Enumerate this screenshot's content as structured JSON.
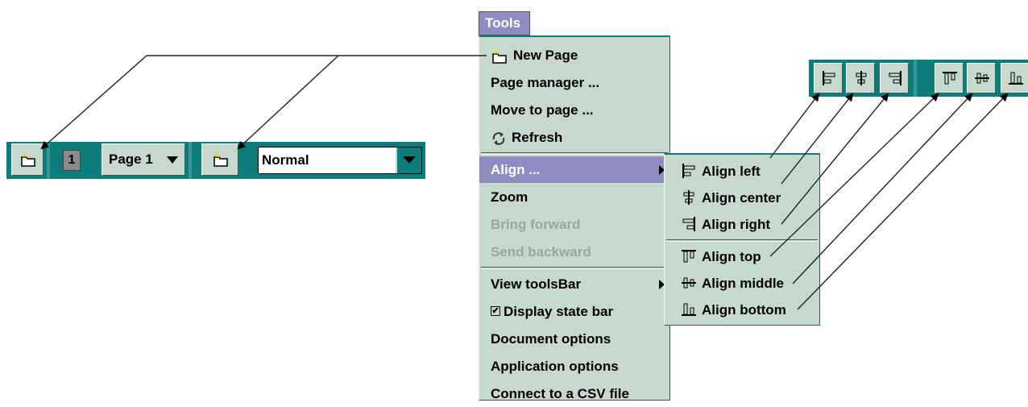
{
  "toolbar": {
    "page_number": "1",
    "page_select": "Page 1",
    "zoom_value": "Normal"
  },
  "menu": {
    "title": "Tools",
    "items": [
      {
        "label": "New Page",
        "icon": "new-page-icon",
        "enabled": true
      },
      {
        "label": "Page manager ...",
        "enabled": true
      },
      {
        "label": "Move to page ...",
        "enabled": true
      },
      {
        "label": "Refresh",
        "icon": "refresh-icon",
        "enabled": true
      },
      {
        "label": "Align ...",
        "enabled": true,
        "submenu": true,
        "selected": true
      },
      {
        "label": "Zoom",
        "enabled": true
      },
      {
        "label": "Bring forward",
        "enabled": false
      },
      {
        "label": "Send backward",
        "enabled": false
      },
      {
        "label": "View toolsBar",
        "enabled": true,
        "submenu": true
      },
      {
        "label": "Display state bar",
        "enabled": true,
        "checked": true
      },
      {
        "label": "Document options",
        "enabled": true
      },
      {
        "label": "Application options",
        "enabled": true
      },
      {
        "label": "Connect to a CSV file",
        "enabled": true
      }
    ]
  },
  "submenu": {
    "items": [
      {
        "label": "Align left",
        "icon": "align-left-icon"
      },
      {
        "label": "Align center",
        "icon": "align-center-icon"
      },
      {
        "label": "Align right",
        "icon": "align-right-icon"
      },
      {
        "label": "Align top",
        "icon": "align-top-icon"
      },
      {
        "label": "Align middle",
        "icon": "align-middle-icon"
      },
      {
        "label": "Align bottom",
        "icon": "align-bottom-icon"
      }
    ]
  },
  "colors": {
    "toolbar_teal": "#0e7c7b",
    "menu_bg": "#c7d8cf",
    "selection": "#8e8cc2",
    "disabled_text": "#9aa8a1"
  }
}
